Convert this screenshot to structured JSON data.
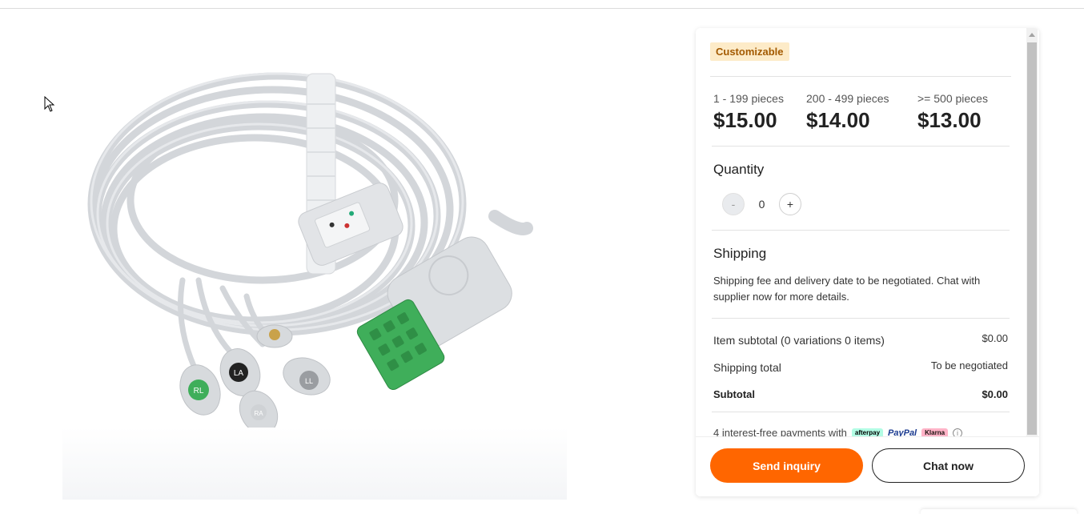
{
  "product": {
    "image_alt": "ECG cable with snap lead wires and green connector",
    "badge": "Customizable"
  },
  "pricing": {
    "tiers": [
      {
        "range": "1 - 199 pieces",
        "price": "$15.00"
      },
      {
        "range": "200 - 499 pieces",
        "price": "$14.00"
      },
      {
        "range": ">= 500 pieces",
        "price": "$13.00"
      }
    ]
  },
  "quantity": {
    "title": "Quantity",
    "minus_label": "-",
    "plus_label": "+",
    "value": "0"
  },
  "shipping": {
    "title": "Shipping",
    "note": "Shipping fee and delivery date to be negotiated. Chat with supplier now for more details."
  },
  "summary": {
    "item_subtotal_label": "Item subtotal (0 variations 0 items)",
    "item_subtotal_value": "$0.00",
    "shipping_total_label": "Shipping total",
    "shipping_total_value": "To be negotiated",
    "subtotal_label": "Subtotal",
    "subtotal_value": "$0.00"
  },
  "payments": {
    "text": "4 interest-free payments with",
    "providers": [
      "afterpay",
      "PayPal",
      "Klarna"
    ]
  },
  "actions": {
    "send_inquiry": "Send inquiry",
    "chat_now": "Chat now"
  },
  "colors": {
    "accent": "#ff6600",
    "badge_bg": "#fdebc8",
    "badge_text": "#a35a00",
    "connector_green": "#3fae5a"
  },
  "labels": {
    "rl": "RL",
    "la": "LA",
    "ll": "LL",
    "ra": "RA"
  }
}
